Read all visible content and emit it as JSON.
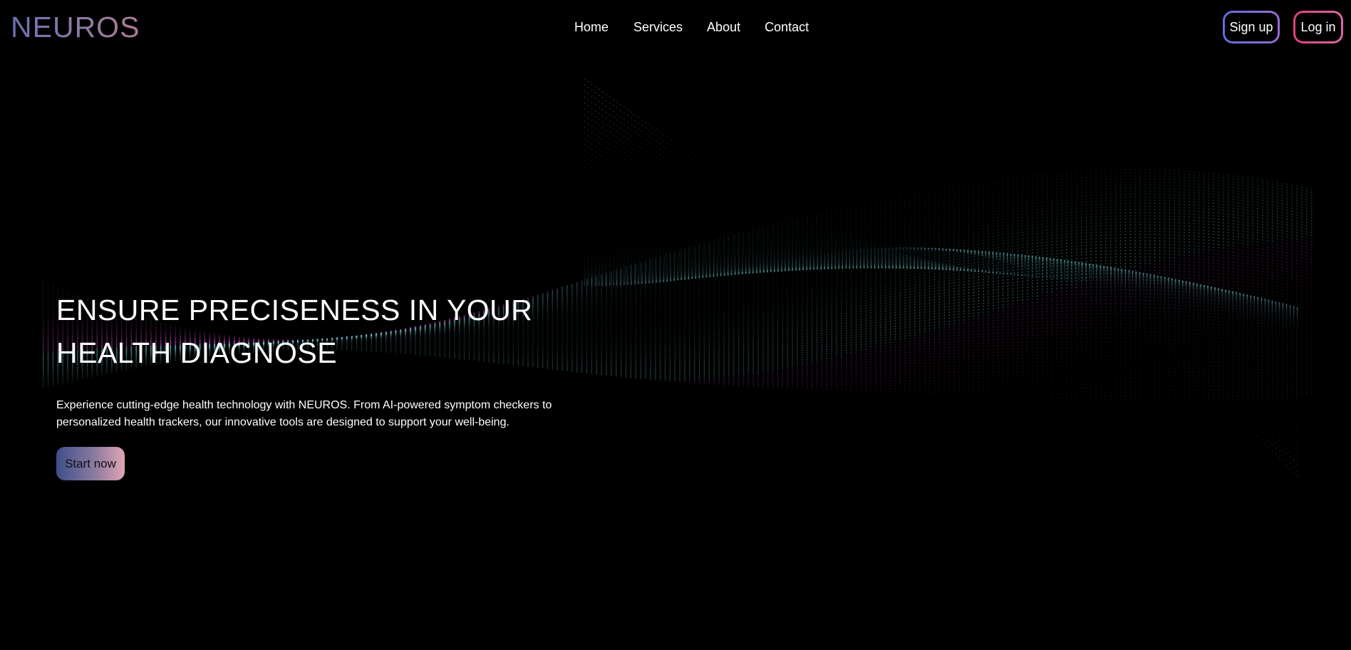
{
  "brand": {
    "name": "NEUROS"
  },
  "nav": {
    "links": [
      {
        "label": "Home"
      },
      {
        "label": "Services"
      },
      {
        "label": "About"
      },
      {
        "label": "Contact"
      }
    ]
  },
  "auth": {
    "signup_label": "Sign up",
    "login_label": "Log in"
  },
  "hero": {
    "title_line1": "ENSURE PRECISENESS IN YOUR",
    "title_line2": "HEALTH DIAGNOSE",
    "description_line1": "Experience cutting-edge health technology with NEUROS. From AI-powered symptom checkers to",
    "description_line2": "personalized health trackers, our innovative tools are designed to support your well-being.",
    "cta_label": "Start now"
  },
  "colors": {
    "background": "#000000",
    "particle_cyan": "#7fe3e6",
    "particle_magenta": "#d04fd0",
    "signup_border": "#7a6ad6",
    "login_border": "#e0407a"
  }
}
